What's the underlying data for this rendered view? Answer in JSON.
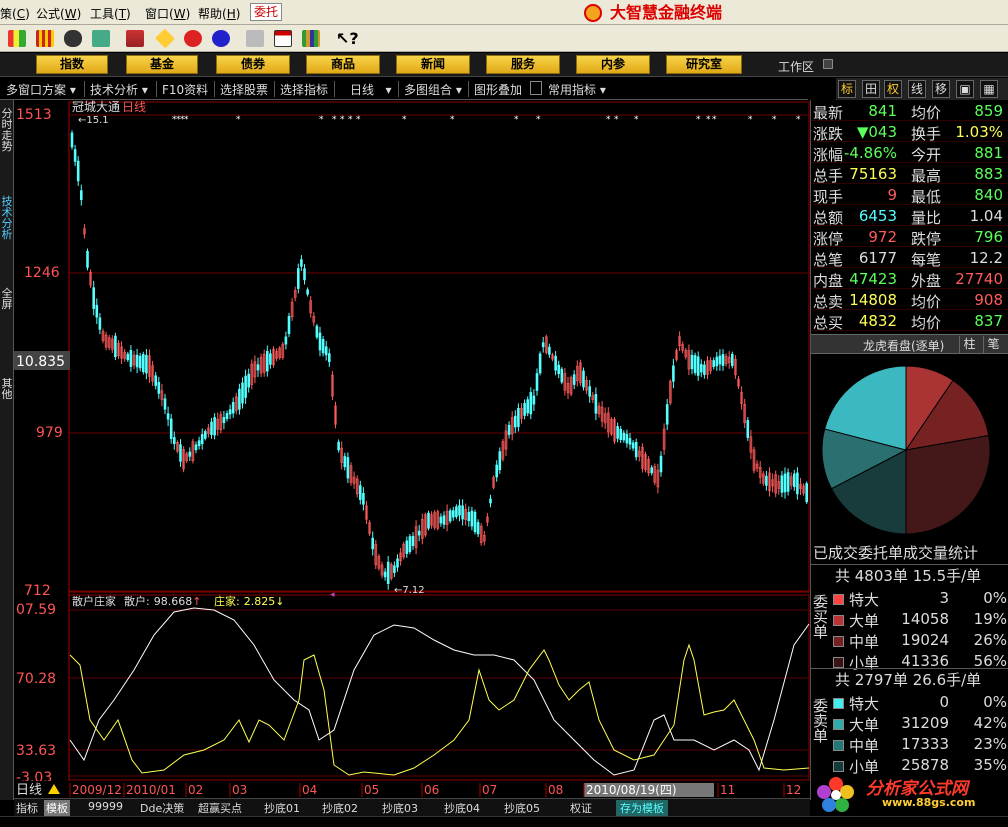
{
  "menu": {
    "items": [
      "策",
      "公式",
      "工具",
      "窗口",
      "帮助"
    ],
    "shortcuts": [
      "C",
      "W",
      "T",
      "W",
      "H"
    ],
    "entrust": "委托",
    "app_title": "大智慧金融终端"
  },
  "toolbar": {
    "icons": [
      "flag-icon",
      "bars-icon",
      "binoculars-icon",
      "tools-icon",
      "news-icon",
      "diamond-icon",
      "circle-icon",
      "info-icon",
      "print-icon",
      "layout-icon",
      "books-icon",
      "help-cursor-icon"
    ]
  },
  "funcbar": {
    "buttons": [
      "指数",
      "基金",
      "债券",
      "商品",
      "新闻",
      "服务",
      "内参",
      "研究室"
    ],
    "workspace": "工作区"
  },
  "tabs": [
    "多窗口方案",
    "技术分析",
    "F10资料",
    "选择股票",
    "选择指标",
    "日线",
    "多图组合",
    "图形叠加",
    "常用指标"
  ],
  "rtools": [
    "标",
    "田",
    "权",
    "线",
    "移",
    "▣",
    "▦"
  ],
  "sidetabs": [
    "分时走势",
    "技术分析",
    "全屏",
    "其他"
  ],
  "chart": {
    "stock": "冠城大通",
    "period": "日线",
    "price_axis": [
      "1513",
      "1246",
      "979",
      "712"
    ],
    "current_price": "10.835",
    "high_label": "15.1",
    "low_label": "7.12",
    "xaxis": [
      "2009/12",
      "2010/01",
      "02",
      "03",
      "04",
      "05",
      "06",
      "07",
      "08",
      "2010/08/19(四)",
      "11",
      "12"
    ],
    "cursor_date": "2010/08/19(四)",
    "period_label": "日线"
  },
  "indicator": {
    "name": "散户庄家",
    "retail_label": "散户:",
    "retail_value": "98.668",
    "dealer_label": "庄家:",
    "dealer_value": "2.825",
    "axis": [
      "07.59",
      "70.28",
      "33.63",
      "-3.03"
    ],
    "retail_color": "#ffffff",
    "dealer_color": "#ffff54"
  },
  "quote": {
    "rows": [
      {
        "l1": "最新",
        "v1": "841",
        "c1": "green",
        "l2": "均价",
        "v2": "859",
        "c2": "green"
      },
      {
        "l1": "涨跌",
        "v1": "▼043",
        "c1": "green",
        "l2": "换手",
        "v2": "1.03%",
        "c2": "yellow"
      },
      {
        "l1": "涨幅",
        "v1": "-4.86%",
        "c1": "green",
        "l2": "今开",
        "v2": "881",
        "c2": "green"
      },
      {
        "l1": "总手",
        "v1": "75163",
        "c1": "yellow",
        "l2": "最高",
        "v2": "883",
        "c2": "green"
      },
      {
        "l1": "现手",
        "v1": "9",
        "c1": "red",
        "l2": "最低",
        "v2": "840",
        "c2": "green"
      },
      {
        "l1": "总额",
        "v1": "6453",
        "c1": "cyan",
        "l2": "量比",
        "v2": "1.04",
        "c2": "white"
      },
      {
        "l1": "涨停",
        "v1": "972",
        "c1": "red",
        "l2": "跌停",
        "v2": "796",
        "c2": "green"
      },
      {
        "l1": "总笔",
        "v1": "6177",
        "c1": "white",
        "l2": "每笔",
        "v2": "12.2",
        "c2": "white"
      },
      {
        "l1": "内盘",
        "v1": "47423",
        "c1": "green",
        "l2": "外盘",
        "v2": "27740",
        "c2": "red"
      },
      {
        "l1": "总卖",
        "v1": "14808",
        "c1": "yellow",
        "l2": "均价",
        "v2": "908",
        "c2": "red"
      },
      {
        "l1": "总买",
        "v1": "4832",
        "c1": "yellow",
        "l2": "均价",
        "v2": "837",
        "c2": "green"
      }
    ],
    "dragon": "龙虎看盘(逐单)",
    "dragon_b1": "柱",
    "dragon_b2": "笔"
  },
  "pie": {
    "slices": [
      {
        "label": "特大买",
        "value": 3,
        "color": "#cc4444"
      },
      {
        "label": "大买",
        "value": 14058,
        "color": "#aa3333"
      },
      {
        "label": "中买",
        "value": 19024,
        "color": "#772222"
      },
      {
        "label": "小买",
        "value": 41336,
        "color": "#441818"
      },
      {
        "label": "小卖",
        "value": 25878,
        "color": "#183c3c"
      },
      {
        "label": "中卖",
        "value": 17333,
        "color": "#2a7070"
      },
      {
        "label": "大卖",
        "value": 31209,
        "color": "#3cb8c0"
      }
    ]
  },
  "stats": {
    "title": "已成交委托单成交量统计",
    "buy": {
      "side": "委买单",
      "total": "共 4803单 15.5手/单",
      "rows": [
        {
          "label": "特大",
          "num": "3",
          "pct": "0%",
          "color": "#ff4444"
        },
        {
          "label": "大单",
          "num": "14058",
          "pct": "19%",
          "color": "#bb3333"
        },
        {
          "label": "中单",
          "num": "19024",
          "pct": "26%",
          "color": "#772222"
        },
        {
          "label": "小单",
          "num": "41336",
          "pct": "56%",
          "color": "#3a1414"
        }
      ]
    },
    "sell": {
      "side": "委卖单",
      "total": "共 2797单 26.6手/单",
      "rows": [
        {
          "label": "特大",
          "num": "0",
          "pct": "0%",
          "color": "#44eeee"
        },
        {
          "label": "大单",
          "num": "31209",
          "pct": "42%",
          "color": "#33aaaa"
        },
        {
          "label": "中单",
          "num": "17333",
          "pct": "23%",
          "color": "#227777"
        },
        {
          "label": "小单",
          "num": "25878",
          "pct": "35%",
          "color": "#143c3c"
        }
      ]
    }
  },
  "bottom_tabs": [
    "指标",
    "模板",
    "99999",
    "Dde决策",
    "超赢买点",
    "抄底01",
    "抄底02",
    "抄底03",
    "抄底04",
    "抄底05",
    "权证",
    "存为模板"
  ],
  "status": "",
  "watermark": {
    "main": "分析家公式网",
    "url": "www.88gs.com"
  }
}
